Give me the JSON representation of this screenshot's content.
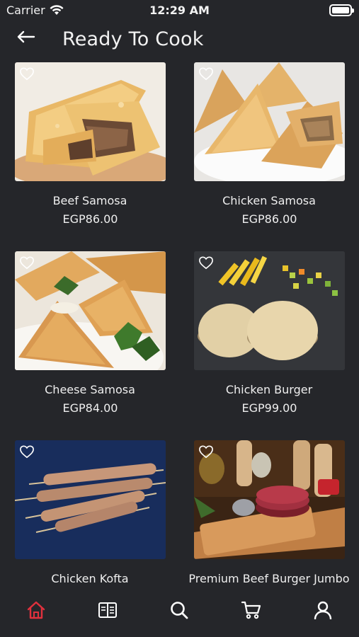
{
  "status": {
    "carrier": "Carrier",
    "time": "12:29 AM"
  },
  "header": {
    "title": "Ready To Cook"
  },
  "products": [
    {
      "name": "Beef Samosa",
      "price": "EGP86.00"
    },
    {
      "name": "Chicken Samosa",
      "price": "EGP86.00"
    },
    {
      "name": "Cheese Samosa",
      "price": "EGP84.00"
    },
    {
      "name": "Chicken Burger",
      "price": "EGP99.00"
    },
    {
      "name": "Chicken Kofta",
      "price": ""
    },
    {
      "name": "Premium Beef Burger Jumbo",
      "price": ""
    }
  ],
  "tabbar": {
    "items": [
      "home-icon",
      "menu-book-icon",
      "search-icon",
      "cart-icon",
      "profile-icon"
    ],
    "active_color": "#e0313d"
  }
}
